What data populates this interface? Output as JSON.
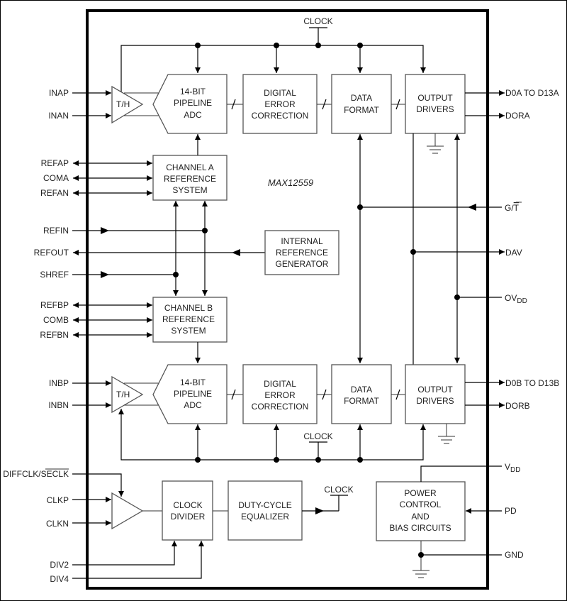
{
  "diagram": {
    "part_number": "MAX12559",
    "clock_label": "CLOCK",
    "blocks": {
      "th_a": "T/H",
      "th_b": "T/H",
      "adc_a": [
        "14-BIT",
        "PIPELINE",
        "ADC"
      ],
      "adc_b": [
        "14-BIT",
        "PIPELINE",
        "ADC"
      ],
      "dec_a": [
        "DIGITAL",
        "ERROR",
        "CORRECTION"
      ],
      "dec_b": [
        "DIGITAL",
        "ERROR",
        "CORRECTION"
      ],
      "fmt_a": [
        "DATA",
        "FORMAT"
      ],
      "fmt_b": [
        "DATA",
        "FORMAT"
      ],
      "drv_a": [
        "OUTPUT",
        "DRIVERS"
      ],
      "drv_b": [
        "OUTPUT",
        "DRIVERS"
      ],
      "ref_a": [
        "CHANNEL A",
        "REFERENCE",
        "SYSTEM"
      ],
      "ref_b": [
        "CHANNEL B",
        "REFERENCE",
        "SYSTEM"
      ],
      "int_ref": [
        "INTERNAL",
        "REFERENCE",
        "GENERATOR"
      ],
      "clk_div": [
        "CLOCK",
        "DIVIDER"
      ],
      "dce": [
        "DUTY-CYCLE",
        "EQUALIZER"
      ],
      "power": [
        "POWER",
        "CONTROL",
        "AND",
        "BIAS CIRCUITS"
      ]
    },
    "left_pins": {
      "inap": "INAP",
      "inan": "INAN",
      "refap": "REFAP",
      "coma": "COMA",
      "refan": "REFAN",
      "refin": "REFIN",
      "refout": "REFOUT",
      "shref": "SHREF",
      "refbp": "REFBP",
      "comb": "COMB",
      "refbn": "REFBN",
      "inbp": "INBP",
      "inbn": "INBN",
      "diffclk": "DIFFCLK/",
      "seclk": "SECLK",
      "clkp": "CLKP",
      "clkn": "CLKN",
      "div2": "DIV2",
      "div4": "DIV4"
    },
    "right_pins": {
      "d_a": "D0A TO D13A",
      "dora": "DORA",
      "gt_g": "G/",
      "gt_t": "T",
      "dav": "DAV",
      "ovdd_main": "OV",
      "ovdd_sub": "DD",
      "d_b": "D0B TO D13B",
      "dorb": "DORB",
      "vdd_main": "V",
      "vdd_sub": "DD",
      "pd": "PD",
      "gnd": "GND"
    }
  }
}
